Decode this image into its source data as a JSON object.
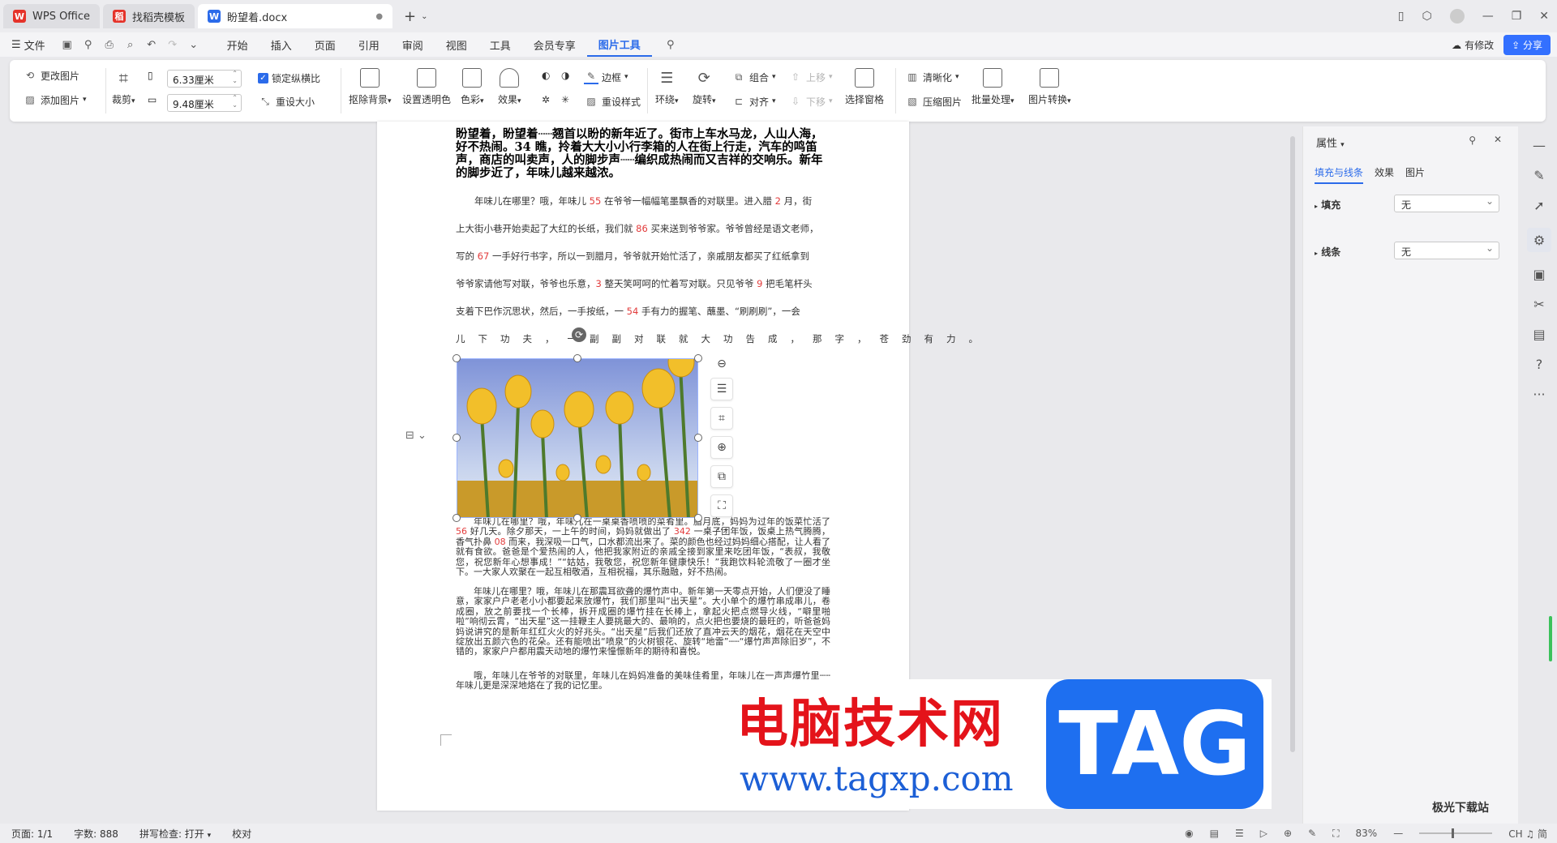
{
  "tabs": [
    {
      "label": "WPS Office"
    },
    {
      "label": "找稻壳模板"
    },
    {
      "label": "盼望着.docx"
    }
  ],
  "menubar": {
    "file": "文件",
    "items": [
      "开始",
      "插入",
      "页面",
      "引用",
      "审阅",
      "视图",
      "工具",
      "会员专享",
      "图片工具"
    ],
    "active": "图片工具",
    "modified": "有修改",
    "share": "分享"
  },
  "ribbon": {
    "change_picture": "更改图片",
    "add_picture": "添加图片",
    "crop": "裁剪",
    "width": "6.33厘米",
    "height": "9.48厘米",
    "lock_ratio": "锁定纵横比",
    "reset_size": "重设大小",
    "remove_bg": "抠除背景",
    "set_transparent": "设置透明色",
    "color": "色彩",
    "effect": "效果",
    "border": "边框",
    "reset_style": "重设样式",
    "wrap": "环绕",
    "rotate": "旋转",
    "group": "组合",
    "align": "对齐",
    "move_up": "上移",
    "move_down": "下移",
    "selection_pane": "选择窗格",
    "sharpen": "清晰化",
    "compress": "压缩图片",
    "batch": "批量处理",
    "convert": "图片转换"
  },
  "document": {
    "title": "盼望着，盼望着┄┄翘首以盼的新年近了。街市上车水马龙，人山人海，好不热闹。34 瞧，拎着大大小小行李箱的人在街上行走，汽车的鸣笛声，商店的叫卖声，人的脚步声┄┄编织成热闹而又吉祥的交响乐。新年的脚步近了，年味儿越来越浓。",
    "lines": [
      [
        "　　年味儿在哪里？哦，年味儿 ",
        "55",
        " 在爷爷一幅幅笔墨飘香的对联里。进入腊 ",
        "2",
        " 月，街"
      ],
      [
        "上大街小巷开始卖起了大红的长纸，我们就 ",
        "86",
        " 买来送到爷爷家。爷爷曾经是语文老师，"
      ],
      [
        "写的 ",
        "67",
        " 一手好行书字，所以一到腊月，爷爷就开始忙活了，亲戚朋友都买了红纸拿到"
      ],
      [
        "爷爷家请他写对联，爷爷也乐意，",
        "3",
        " 整天笑呵呵的忙着写对联。只见爷爷 ",
        "9",
        " 把毛笔杆头"
      ],
      [
        "支着下巴作沉思状，然后，一手按纸，一 ",
        "54",
        " 手有力的握笔、蘸墨、“刷刷刷”，一会"
      ]
    ],
    "wide_line": "儿下功夫，一副副对联就大功告成，那字，苍劲有力。",
    "para2_a": "年味儿在哪里？哦，年味儿在一桌桌香喷喷的菜肴里。腊月底，妈妈为过年的饭菜忙活了 ",
    "para2_n1": "56",
    "para2_b": " 好几天。除夕那天，一上午的时间，妈妈就做出了 ",
    "para2_n2": "342",
    "para2_c": " 一桌子团年饭，饭桌上热气腾腾，香气扑鼻 ",
    "para2_n3": "08",
    "para2_d": " 而来，我深吸一口气，口水都流出来了。菜的颜色也经过妈妈细心搭配，让人看了就有食欲。爸爸是个爱热闹的人，他把我家附近的亲戚全接到家里来吃团年饭，“表叔，我敬您，祝您新年心想事成！”“姑姑，我敬您，祝您新年健康快乐！”我跑饮料轮流敬了一圈才坐下。一大家人欢聚在一起互相敬酒，互相祝福，其乐融融，好不热闹。",
    "para3": "年味儿在哪里？哦，年味儿在那震耳欲聋的爆竹声中。新年第一天零点开始，人们便没了睡意，家家户户老老小小都要起来放爆竹，我们那里叫“出天星”。大小单个的爆竹串成串儿，卷成圈，放之前要找一个长棒，拆开成圈的爆竹挂在长棒上，拿起火把点燃导火线，“噼里啪啦”响彻云霄，“出天星”这一挂鞭主人要挑最大的、最响的，点火把也要烧的最旺的，听爸爸妈妈说讲究的是新年红红火火的好兆头。“出天星”后我们还放了直冲云天的烟花，烟花在天空中绽放出五颜六色的花朵。还有能喷出“喷泉”的火树银花、旋转“地雷”┄┄“爆竹声声除旧岁”，不错的，家家户户都用震天动地的爆竹来憧憬新年的期待和喜悦。",
    "para4": "哦，年味儿在爷爷的对联里，年味儿在妈妈准备的美味佳肴里，年味儿在一声声爆竹里┄┄年味儿更是深深地烙在了我的记忆里。"
  },
  "properties": {
    "title": "属性",
    "tabs": [
      "填充与线条",
      "效果",
      "图片"
    ],
    "fill_label": "填充",
    "fill_value": "无",
    "line_label": "线条",
    "line_value": "无"
  },
  "statusbar": {
    "page": "页面: 1/1",
    "words": "字数: 888",
    "spell": "拼写检查: 打开",
    "proof": "校对",
    "zoom": "83%"
  },
  "watermark": {
    "cn": "电脑技术网",
    "url": "www.tagxp.com",
    "tag": "TAG",
    "corner": "极光下载站"
  },
  "ime": "CH ♫ 简",
  "colors": {
    "accent": "#2b6bea",
    "share": "#3370ff",
    "number_red": "#e23b3b"
  }
}
